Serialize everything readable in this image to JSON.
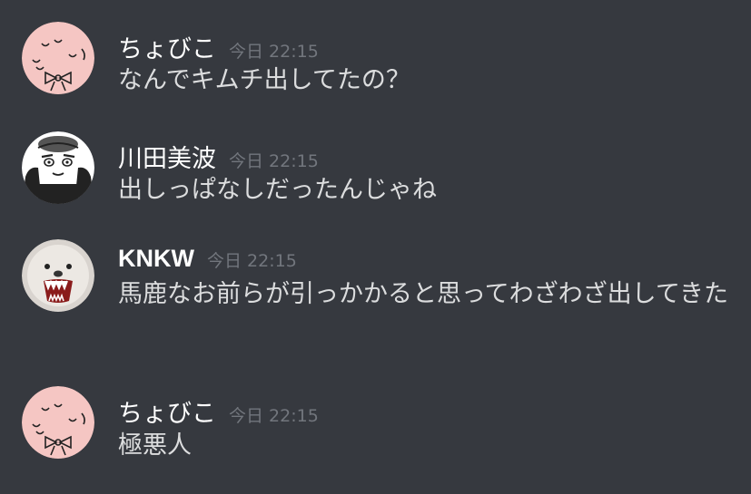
{
  "colors": {
    "background": "#36393f",
    "username": "#ffffff",
    "timestamp": "#72767d",
    "text": "#dcddde"
  },
  "messages": [
    {
      "author": "ちょびこ",
      "timestamp": "今日 22:15",
      "content": "なんでキムチ出してたの？",
      "avatar": "chobiko-avatar"
    },
    {
      "author": "川田美波",
      "timestamp": "今日 22:15",
      "content": "出しっぱなしだったんじゃね",
      "avatar": "kawada-avatar"
    },
    {
      "author": "KNKW",
      "timestamp": "今日 22:15",
      "content": "馬鹿なお前らが引っかかると思ってわざわざ出してきた",
      "avatar": "knkw-avatar"
    },
    {
      "author": "ちょびこ",
      "timestamp": "今日 22:15",
      "content": "極悪人",
      "avatar": "chobiko-avatar"
    }
  ]
}
